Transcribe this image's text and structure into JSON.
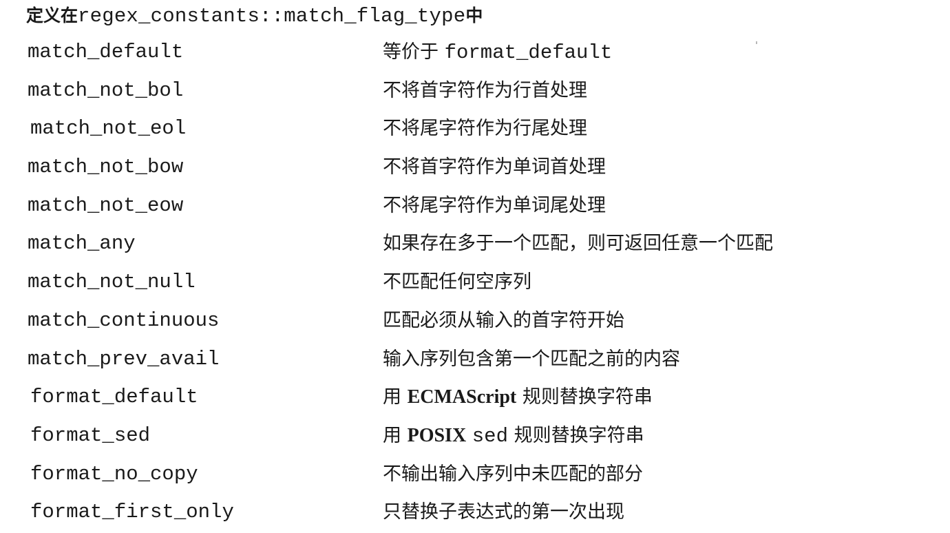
{
  "title": {
    "prefix": "定义在",
    "namespace": "regex_constants::match_flag_type",
    "suffix": "中"
  },
  "flags": [
    {
      "name": "match_default",
      "desc": "等价于 format_default"
    },
    {
      "name": "match_not_bol",
      "desc": "不将首字符作为行首处理"
    },
    {
      "name": "match_not_eol",
      "desc": "不将尾字符作为行尾处理"
    },
    {
      "name": "match_not_bow",
      "desc": "不将首字符作为单词首处理"
    },
    {
      "name": "match_not_eow",
      "desc": "不将尾字符作为单词尾处理"
    },
    {
      "name": "match_any",
      "desc": "如果存在多于一个匹配，则可返回任意一个匹配"
    },
    {
      "name": "match_not_null",
      "desc": "不匹配任何空序列"
    },
    {
      "name": "match_continuous",
      "desc": "匹配必须从输入的首字符开始"
    },
    {
      "name": "match_prev_avail",
      "desc": "输入序列包含第一个匹配之前的内容"
    },
    {
      "name": "format_default",
      "desc": "用 ECMAScript 规则替换字符串"
    },
    {
      "name": "format_sed",
      "desc": "用 POSIX sed 规则替换字符串"
    },
    {
      "name": "format_no_copy",
      "desc": "不输出输入序列中未匹配的部分"
    },
    {
      "name": "format_first_only",
      "desc": "只替换子表达式的第一次出现"
    }
  ]
}
